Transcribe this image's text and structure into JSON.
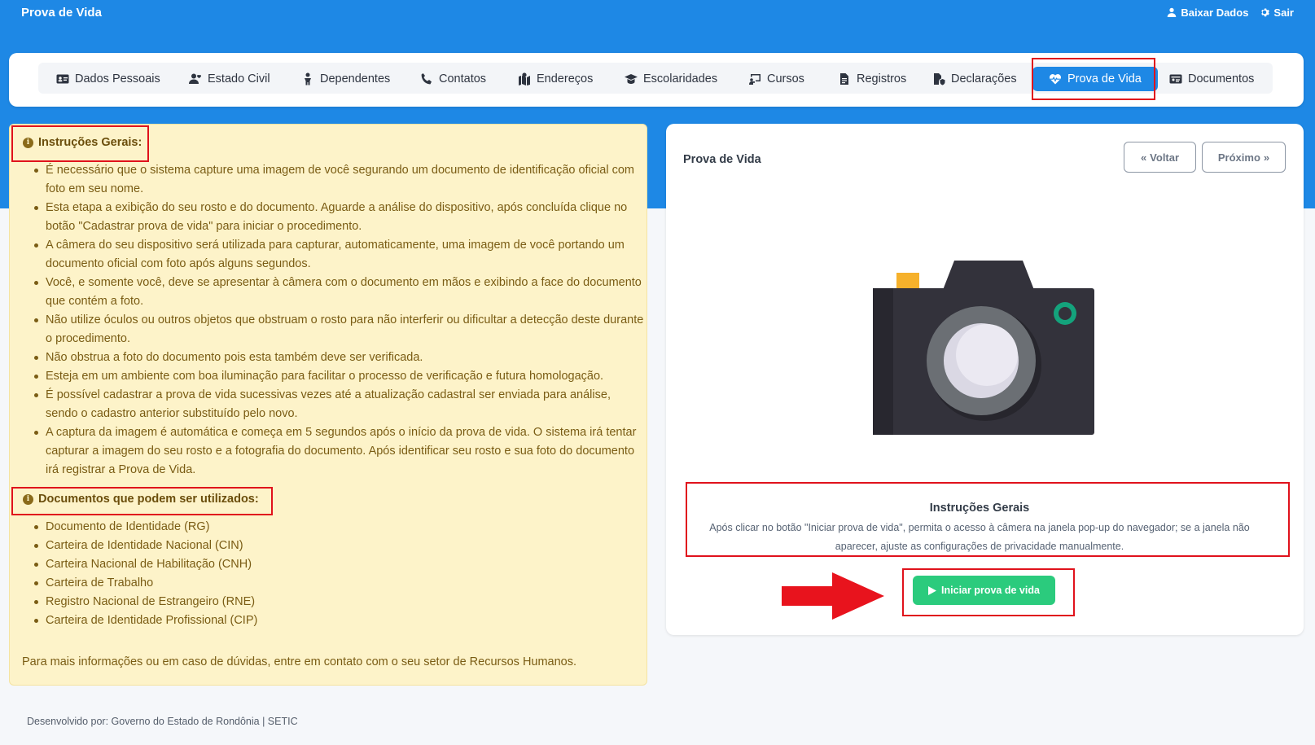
{
  "app": {
    "title": "Prova de Vida",
    "actions": [
      {
        "label": "Baixar Dados",
        "icon": "user-icon"
      },
      {
        "label": "Sair",
        "icon": "gear-icon"
      }
    ]
  },
  "tabs": [
    {
      "label": "Dados Pessoais",
      "icon": "id-card-icon"
    },
    {
      "label": "Estado Civil",
      "icon": "user-heart-icon"
    },
    {
      "label": "Dependentes",
      "icon": "child-icon"
    },
    {
      "label": "Contatos",
      "icon": "phone-icon"
    },
    {
      "label": "Endereços",
      "icon": "map-location-icon"
    },
    {
      "label": "Escolaridades",
      "icon": "graduation-cap-icon"
    },
    {
      "label": "Cursos",
      "icon": "chalkboard-icon"
    },
    {
      "label": "Registros",
      "icon": "file-icon"
    },
    {
      "label": "Declarações",
      "icon": "file-shield-icon"
    },
    {
      "label": "Prova de Vida",
      "icon": "heart-pulse-icon",
      "active": true
    },
    {
      "label": "Documentos",
      "icon": "address-card-icon"
    }
  ],
  "instructions": {
    "heading": "Instruções Gerais:",
    "items": [
      "É necessário que o sistema capture uma imagem de você segurando um documento de identificação oficial com foto em seu nome.",
      "Esta etapa a exibição do seu rosto e do documento. Aguarde a análise do dispositivo, após concluída clique no botão \"Cadastrar prova de vida\" para iniciar o procedimento.",
      "A câmera do seu dispositivo será utilizada para capturar, automaticamente, uma imagem de você portando um documento oficial com foto após alguns segundos.",
      "Você, e somente você, deve se apresentar à câmera com o documento em mãos e exibindo a face do documento que contém a foto.",
      "Não utilize óculos ou outros objetos que obstruam o rosto para não interferir ou dificultar a detecção deste durante o procedimento.",
      "Não obstrua a foto do documento pois esta também deve ser verificada.",
      "Esteja em um ambiente com boa iluminação para facilitar o processo de verificação e futura homologação.",
      "É possível cadastrar a prova de vida sucessivas vezes até a atualização cadastral ser enviada para análise, sendo o cadastro anterior substituído pelo novo.",
      "A captura da imagem é automática e começa em 5 segundos após o início da prova de vida. O sistema irá tentar capturar a imagem do seu rosto e a fotografia do documento. Após identificar seu rosto e sua foto do documento irá registrar a Prova de Vida."
    ]
  },
  "documents": {
    "heading": "Documentos que podem ser utilizados:",
    "items": [
      "Documento de Identidade (RG)",
      "Carteira de Identidade Nacional (CIN)",
      "Carteira Nacional de Habilitação (CNH)",
      "Carteira de Trabalho",
      "Registro Nacional de Estrangeiro (RNE)",
      "Carteira de Identidade Profissional (CIP)"
    ]
  },
  "left_footer": "Para mais informações ou em caso de dúvidas, entre em contato com o seu setor de Recursos Humanos.",
  "right": {
    "title": "Prova de Vida",
    "back_label": "Voltar",
    "next_label": "Próximo",
    "image_icon": "camera-icon",
    "box_title": "Instruções Gerais",
    "box_text": "Após clicar no botão \"Iniciar prova de vida\", permita o acesso à câmera na janela pop-up do navegador; se a janela não aparecer, ajuste as configurações de privacidade manualmente.",
    "start_label": "Iniciar prova de vida"
  },
  "footer": "Desenvolvido por: Governo do Estado de Rondônia | SETIC",
  "colors": {
    "primary": "#1e88e5",
    "success": "#2bcb7d",
    "warning_bg": "#fdf3c9",
    "highlight": "#e0121c"
  }
}
